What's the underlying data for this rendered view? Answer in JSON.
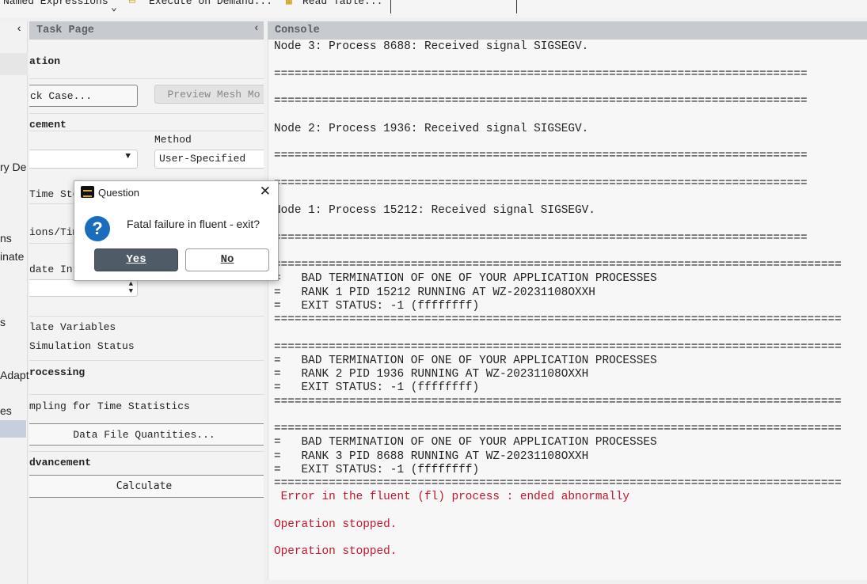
{
  "toolbar": {
    "named_expressions": "Named Expressions",
    "execute_on_demand": "Execute on Demand...",
    "read_table": "Read Table..."
  },
  "sidebar": {
    "items": [
      "ry De",
      "ns",
      "inate",
      "s",
      "Adapt",
      "es"
    ]
  },
  "task_page": {
    "title": "Task Page",
    "section_initialization": "ation",
    "check_case": "ck Case...",
    "preview_mesh": "Preview Mesh Mo",
    "section_mesh_motion": "cement",
    "method_label": "Method",
    "method_value": "User-Specified",
    "time_step_label": "Time Ste",
    "iterations_label": "ions/Tim",
    "update_interval_label": "date Int",
    "animate_variables": "late Variables",
    "simulation_status": "Simulation Status",
    "section_processing": "rocessing",
    "sampling": "mpling for Time Statistics",
    "data_file_quantities": "Data File Quantities...",
    "section_advancement": "dvancement",
    "calculate": "Calculate"
  },
  "console": {
    "title": "Console",
    "lines": [
      {
        "text": "Node 3: Process 8688: Received signal SIGSEGV.",
        "type": "normal"
      },
      {
        "text": "",
        "type": "normal"
      },
      {
        "text": "==============================================================================",
        "type": "normal"
      },
      {
        "text": "",
        "type": "normal"
      },
      {
        "text": "==============================================================================",
        "type": "normal"
      },
      {
        "text": "",
        "type": "normal"
      },
      {
        "text": "Node 2: Process 1936: Received signal SIGSEGV.",
        "type": "normal"
      },
      {
        "text": "",
        "type": "normal"
      },
      {
        "text": "==============================================================================",
        "type": "normal"
      },
      {
        "text": "",
        "type": "normal"
      },
      {
        "text": "==============================================================================",
        "type": "normal"
      },
      {
        "text": "",
        "type": "normal"
      },
      {
        "text": "Node 1: Process 15212: Received signal SIGSEGV.",
        "type": "normal"
      },
      {
        "text": "",
        "type": "normal"
      },
      {
        "text": "==============================================================================",
        "type": "normal"
      },
      {
        "text": "",
        "type": "normal"
      },
      {
        "text": "===================================================================================",
        "type": "normal"
      },
      {
        "text": "=   BAD TERMINATION OF ONE OF YOUR APPLICATION PROCESSES",
        "type": "normal"
      },
      {
        "text": "=   RANK 1 PID 15212 RUNNING AT WZ-20231108OXXH",
        "type": "normal"
      },
      {
        "text": "=   EXIT STATUS: -1 (ffffffff)",
        "type": "normal"
      },
      {
        "text": "===================================================================================",
        "type": "normal"
      },
      {
        "text": "",
        "type": "normal"
      },
      {
        "text": "===================================================================================",
        "type": "normal"
      },
      {
        "text": "=   BAD TERMINATION OF ONE OF YOUR APPLICATION PROCESSES",
        "type": "normal"
      },
      {
        "text": "=   RANK 2 PID 1936 RUNNING AT WZ-20231108OXXH",
        "type": "normal"
      },
      {
        "text": "=   EXIT STATUS: -1 (ffffffff)",
        "type": "normal"
      },
      {
        "text": "===================================================================================",
        "type": "normal"
      },
      {
        "text": "",
        "type": "normal"
      },
      {
        "text": "===================================================================================",
        "type": "normal"
      },
      {
        "text": "=   BAD TERMINATION OF ONE OF YOUR APPLICATION PROCESSES",
        "type": "normal"
      },
      {
        "text": "=   RANK 3 PID 8688 RUNNING AT WZ-20231108OXXH",
        "type": "normal"
      },
      {
        "text": "=   EXIT STATUS: -1 (ffffffff)",
        "type": "normal"
      },
      {
        "text": "===================================================================================",
        "type": "normal"
      },
      {
        "text": " Error in the fluent (fl) process : ended abnormally",
        "type": "error"
      },
      {
        "text": "",
        "type": "normal"
      },
      {
        "text": "Operation stopped.",
        "type": "error"
      },
      {
        "text": "",
        "type": "normal"
      },
      {
        "text": "Operation stopped.",
        "type": "error"
      }
    ]
  },
  "dialog": {
    "title": "Question",
    "message": "Fatal failure in fluent - exit?",
    "yes": "Yes",
    "no": "No",
    "icon": "question-icon"
  },
  "colors": {
    "error": "#c0152a",
    "yes_button": "#4f5b66",
    "header": "#c7cbcf",
    "question_icon": "#1a6dbd"
  }
}
